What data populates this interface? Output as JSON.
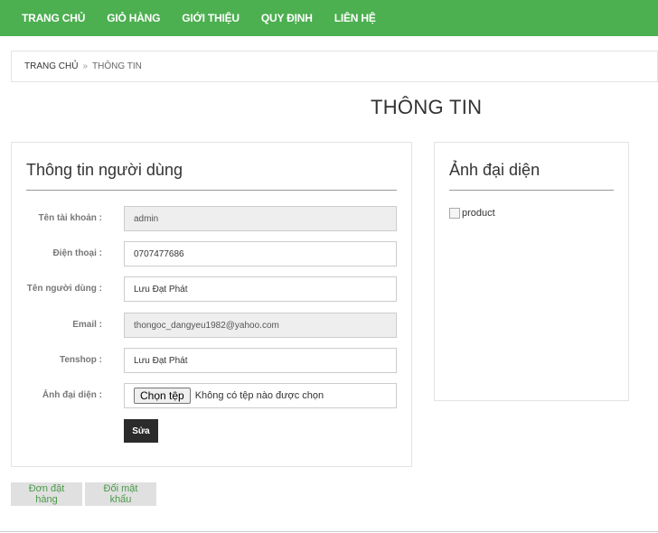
{
  "nav": {
    "items": [
      {
        "label": "TRANG CHỦ"
      },
      {
        "label": "GIỎ HÀNG"
      },
      {
        "label": "GIỚI THIỆU"
      },
      {
        "label": "QUY ĐỊNH"
      },
      {
        "label": "LIÊN HỆ"
      }
    ]
  },
  "breadcrumb": {
    "home": "TRANG CHỦ",
    "separator": "»",
    "current": "THÔNG TIN"
  },
  "page": {
    "title": "THÔNG TIN"
  },
  "user_panel": {
    "heading": "Thông tin người dùng",
    "fields": {
      "username": {
        "label": "Tên tài khoản :",
        "value": "admin"
      },
      "phone": {
        "label": "Điện thoại :",
        "value": "0707477686"
      },
      "fullname": {
        "label": "Tên người dùng :",
        "value": "Lưu Đạt Phát"
      },
      "email": {
        "label": "Email :",
        "value": "thongoc_dangyeu1982@yahoo.com"
      },
      "tenshop": {
        "label": "Tenshop :",
        "value": "Lưu Đạt Phát"
      },
      "avatar": {
        "label": "Ảnh đại diện :",
        "button": "Chọn tệp",
        "status": "Không có tệp nào được chọn"
      }
    },
    "submit_label": "Sửa"
  },
  "avatar_panel": {
    "heading": "Ảnh đại diện",
    "image_alt": "product"
  },
  "actions": {
    "orders_label": "Đơn đặt hàng",
    "change_password_label": "Đổi mật khẩu"
  },
  "colors": {
    "nav_bg": "#4caf50",
    "submit_bg": "#2b2b2b",
    "action_text": "#4a9a4a"
  }
}
